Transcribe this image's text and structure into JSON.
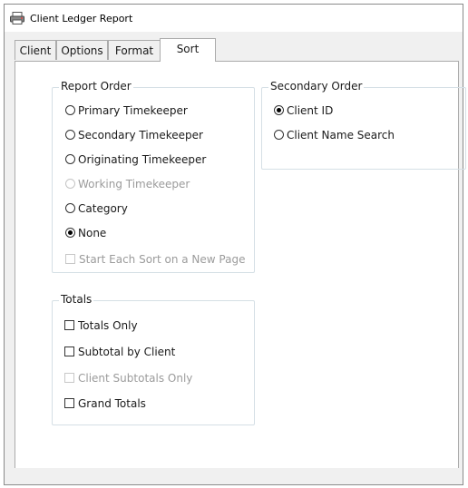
{
  "window": {
    "title": "Client Ledger Report"
  },
  "tabs": [
    {
      "label": "Client"
    },
    {
      "label": "Options"
    },
    {
      "label": "Format"
    },
    {
      "label": "Sort",
      "active": true
    }
  ],
  "report_order": {
    "title": "Report Order",
    "options": [
      {
        "label": "Primary Timekeeper",
        "checked": false,
        "disabled": false
      },
      {
        "label": "Secondary Timekeeper",
        "checked": false,
        "disabled": false
      },
      {
        "label": "Originating Timekeeper",
        "checked": false,
        "disabled": false
      },
      {
        "label": "Working Timekeeper",
        "checked": false,
        "disabled": true
      },
      {
        "label": "Category",
        "checked": false,
        "disabled": false
      },
      {
        "label": "None",
        "checked": true,
        "disabled": false
      }
    ],
    "new_page_checkbox": {
      "label": "Start Each Sort on a New Page",
      "checked": false,
      "disabled": true
    }
  },
  "secondary_order": {
    "title": "Secondary Order",
    "options": [
      {
        "label": "Client ID",
        "checked": true
      },
      {
        "label": "Client Name Search",
        "checked": false
      }
    ]
  },
  "totals": {
    "title": "Totals",
    "options": [
      {
        "label": "Totals Only",
        "checked": false,
        "disabled": false
      },
      {
        "label": "Subtotal by Client",
        "checked": false,
        "disabled": false
      },
      {
        "label": "Client Subtotals Only",
        "checked": false,
        "disabled": true
      },
      {
        "label": "Grand Totals",
        "checked": false,
        "disabled": false
      }
    ]
  },
  "icons": {
    "app": "app-printer-icon"
  }
}
